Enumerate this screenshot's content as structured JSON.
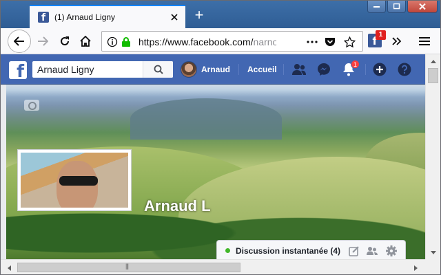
{
  "browser": {
    "tab": {
      "favicon": "f",
      "title": "(1) Arnaud Ligny"
    },
    "new_tab_symbol": "+",
    "url": {
      "main": "https://www.facebook.com/",
      "dim": "narno"
    },
    "extension": {
      "letter": "f",
      "badge": "1"
    }
  },
  "facebook": {
    "logo": "f",
    "search": {
      "value": "Arnaud Ligny"
    },
    "profile_name": "Arnaud",
    "home_label": "Accueil",
    "notifications_badge": "1",
    "cover_owner_name": "Arnaud L",
    "chat": {
      "label": "Discussion instantanée (4)",
      "status_color": "#42b72a"
    }
  },
  "colors": {
    "fb_blue": "#4267b2",
    "tab_accent": "#0a84ff",
    "badge_red": "#fa3e3e"
  }
}
